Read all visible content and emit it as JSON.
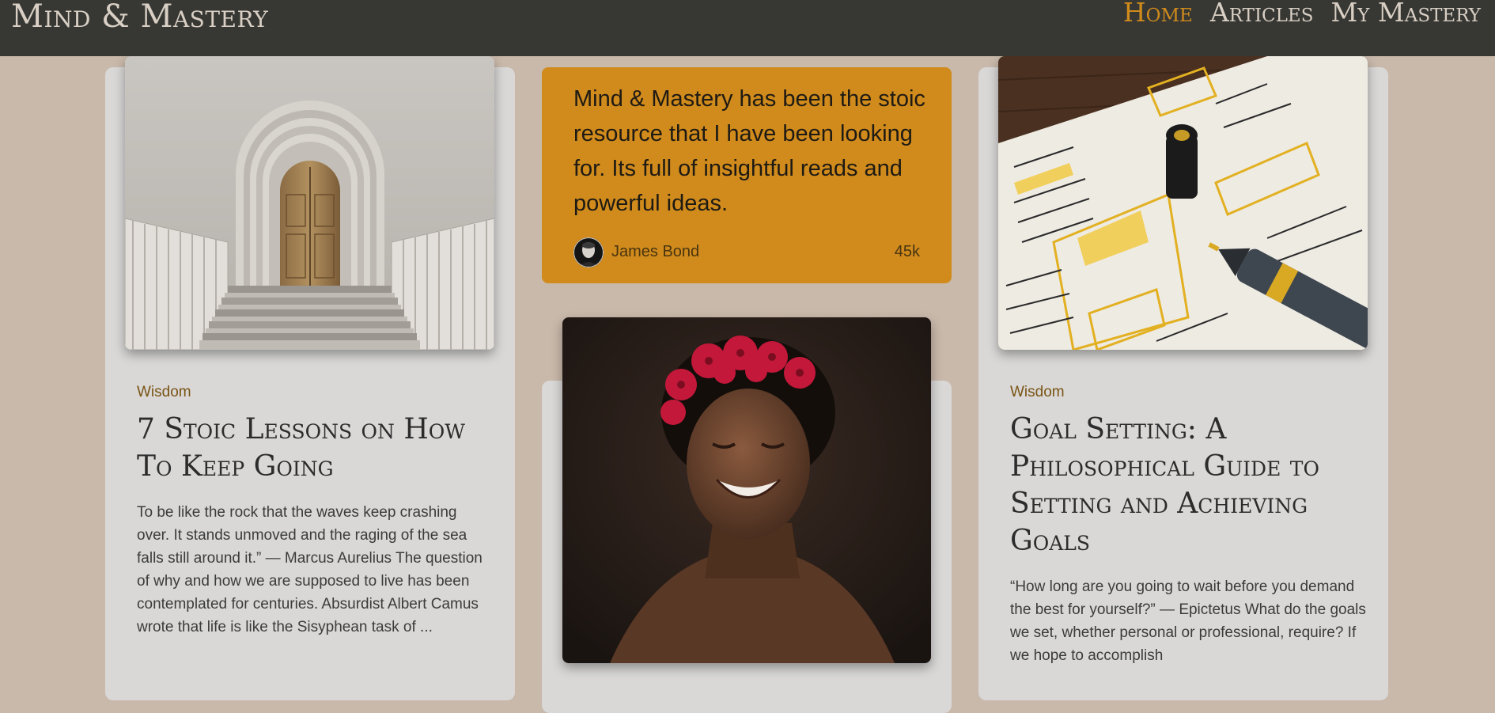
{
  "header": {
    "brand": "Mind & Mastery",
    "nav": [
      {
        "label": "Home",
        "active": true
      },
      {
        "label": "Articles",
        "active": false
      },
      {
        "label": "My Mastery",
        "active": false
      }
    ]
  },
  "cards": {
    "left": {
      "category": "Wisdom",
      "title": "7 Stoic Lessons on How To Keep Going",
      "excerpt": "To be like the rock that the waves keep crashing over. It stands unmoved and the raging of the sea falls still around it.” — Marcus Aurelius The question of why and how we are supposed to live has been contemplated for centuries. Absurdist Albert Camus wrote that life is like the Sisyphean task of ..."
    },
    "right": {
      "category": "Wisdom",
      "title": "Goal Setting: A Philosophical Guide to Setting and Achieving Goals",
      "excerpt": "“How long are you going to wait before you demand the best for yourself?” — Epictetus What do the goals we set, whether personal or professional, require? If we hope to accomplish"
    }
  },
  "testimonial": {
    "text": "Mind & Mastery has been the stoic resource that I have been looking for. Its full of insightful reads and powerful ideas.",
    "author": "James Bond",
    "count": "45k"
  },
  "colors": {
    "accent": "#d08b1c",
    "header_bg": "#373834",
    "page_bg": "#c9b9ab",
    "card_bg": "#d9d8d7"
  }
}
